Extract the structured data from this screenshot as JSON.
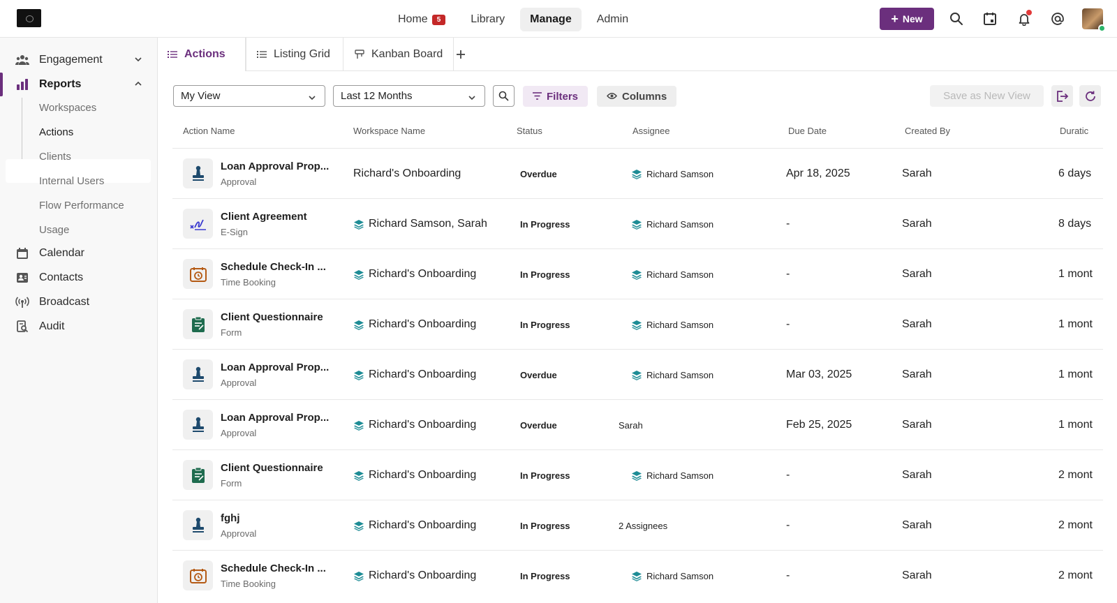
{
  "topnav": {
    "items": [
      {
        "label": "Home",
        "badge": "5"
      },
      {
        "label": "Library"
      },
      {
        "label": "Manage",
        "active": true
      },
      {
        "label": "Admin"
      }
    ],
    "new_label": "New",
    "brand_color": "#6b2f7d"
  },
  "sidebar": {
    "engagement": "Engagement",
    "reports": "Reports",
    "reports_sub": [
      "Workspaces",
      "Actions",
      "Clients",
      "Internal Users",
      "Flow Performance",
      "Usage"
    ],
    "calendar": "Calendar",
    "contacts": "Contacts",
    "broadcast": "Broadcast",
    "audit": "Audit"
  },
  "tabs": [
    {
      "label": "Actions",
      "active": true
    },
    {
      "label": "Listing Grid"
    },
    {
      "label": "Kanban Board"
    }
  ],
  "toolbar": {
    "view_select": "My View",
    "range_select": "Last 12 Months",
    "filters_label": "Filters",
    "columns_label": "Columns",
    "save_view_label": "Save as New View"
  },
  "table": {
    "columns": [
      "Action Name",
      "Workspace Name",
      "Status",
      "Assignee",
      "Due Date",
      "Created By",
      "Duratic"
    ],
    "rows": [
      {
        "icon": "approval-stamp-icon",
        "name": "Loan Approval Prop...",
        "type": "Approval",
        "workspace": "Richard's Onboarding",
        "ws_icon": false,
        "status": "Overdue",
        "assignee": "Richard Samson",
        "as_icon": true,
        "due": "Apr 18, 2025",
        "created_by": "Sarah",
        "duration": "6 days"
      },
      {
        "icon": "esign-icon",
        "name": "Client Agreement",
        "type": "E-Sign",
        "workspace": "Richard Samson, Sarah",
        "ws_icon": true,
        "status": "In Progress",
        "assignee": "Richard Samson",
        "as_icon": true,
        "due": "-",
        "created_by": "Sarah",
        "duration": "8 days"
      },
      {
        "icon": "calendar-clock-icon",
        "name": "Schedule Check-In ...",
        "type": "Time Booking",
        "workspace": "Richard's Onboarding",
        "ws_icon": true,
        "status": "In Progress",
        "assignee": "Richard Samson",
        "as_icon": true,
        "due": "-",
        "created_by": "Sarah",
        "duration": "1 mont"
      },
      {
        "icon": "clipboard-form-icon",
        "name": "Client Questionnaire",
        "type": "Form",
        "workspace": "Richard's Onboarding",
        "ws_icon": true,
        "status": "In Progress",
        "assignee": "Richard Samson",
        "as_icon": true,
        "due": "-",
        "created_by": "Sarah",
        "duration": "1 mont"
      },
      {
        "icon": "approval-stamp-icon",
        "name": "Loan Approval Prop...",
        "type": "Approval",
        "workspace": "Richard's Onboarding",
        "ws_icon": true,
        "status": "Overdue",
        "assignee": "Richard Samson",
        "as_icon": true,
        "due": "Mar 03, 2025",
        "created_by": "Sarah",
        "duration": "1 mont"
      },
      {
        "icon": "approval-stamp-icon",
        "name": "Loan Approval Prop...",
        "type": "Approval",
        "workspace": "Richard's Onboarding",
        "ws_icon": true,
        "status": "Overdue",
        "assignee": "Sarah",
        "as_icon": false,
        "due": "Feb 25, 2025",
        "created_by": "Sarah",
        "duration": "1 mont"
      },
      {
        "icon": "clipboard-form-icon",
        "name": "Client Questionnaire",
        "type": "Form",
        "workspace": "Richard's Onboarding",
        "ws_icon": true,
        "status": "In Progress",
        "assignee": "Richard Samson",
        "as_icon": true,
        "due": "-",
        "created_by": "Sarah",
        "duration": "2 mont"
      },
      {
        "icon": "approval-stamp-icon",
        "name": "fghj",
        "type": "Approval",
        "workspace": "Richard's Onboarding",
        "ws_icon": true,
        "status": "In Progress",
        "assignee": "2 Assignees",
        "as_icon": false,
        "due": "-",
        "created_by": "Sarah",
        "duration": "2 mont"
      },
      {
        "icon": "calendar-clock-icon",
        "name": "Schedule Check-In ...",
        "type": "Time Booking",
        "workspace": "Richard's Onboarding",
        "ws_icon": true,
        "status": "In Progress",
        "assignee": "Richard Samson",
        "as_icon": true,
        "due": "-",
        "created_by": "Sarah",
        "duration": "2 mont"
      }
    ]
  }
}
